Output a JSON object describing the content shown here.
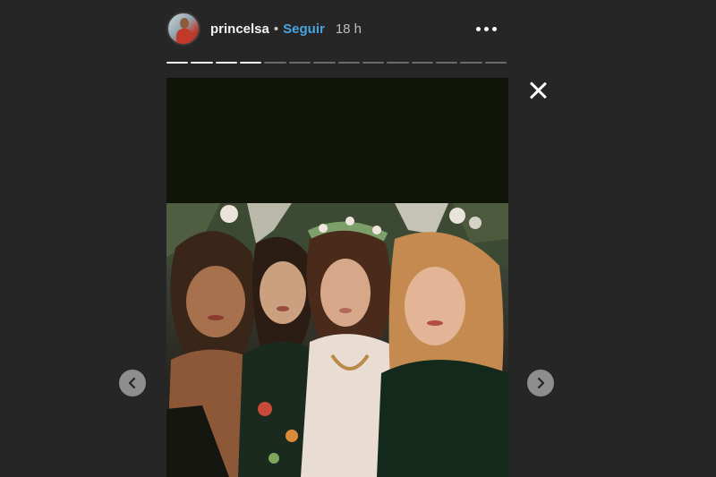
{
  "header": {
    "username": "princelsa",
    "separator": "•",
    "follow_label": "Seguir",
    "time_ago": "18 h"
  },
  "progress": {
    "total_segments": 14,
    "completed_segments": 4
  },
  "icons": {
    "more": "more-options-icon",
    "close": "close-icon",
    "prev": "chevron-left-icon",
    "next": "chevron-right-icon"
  },
  "colors": {
    "background": "#262626",
    "follow": "#4aa3df",
    "story_top": "#111409"
  }
}
